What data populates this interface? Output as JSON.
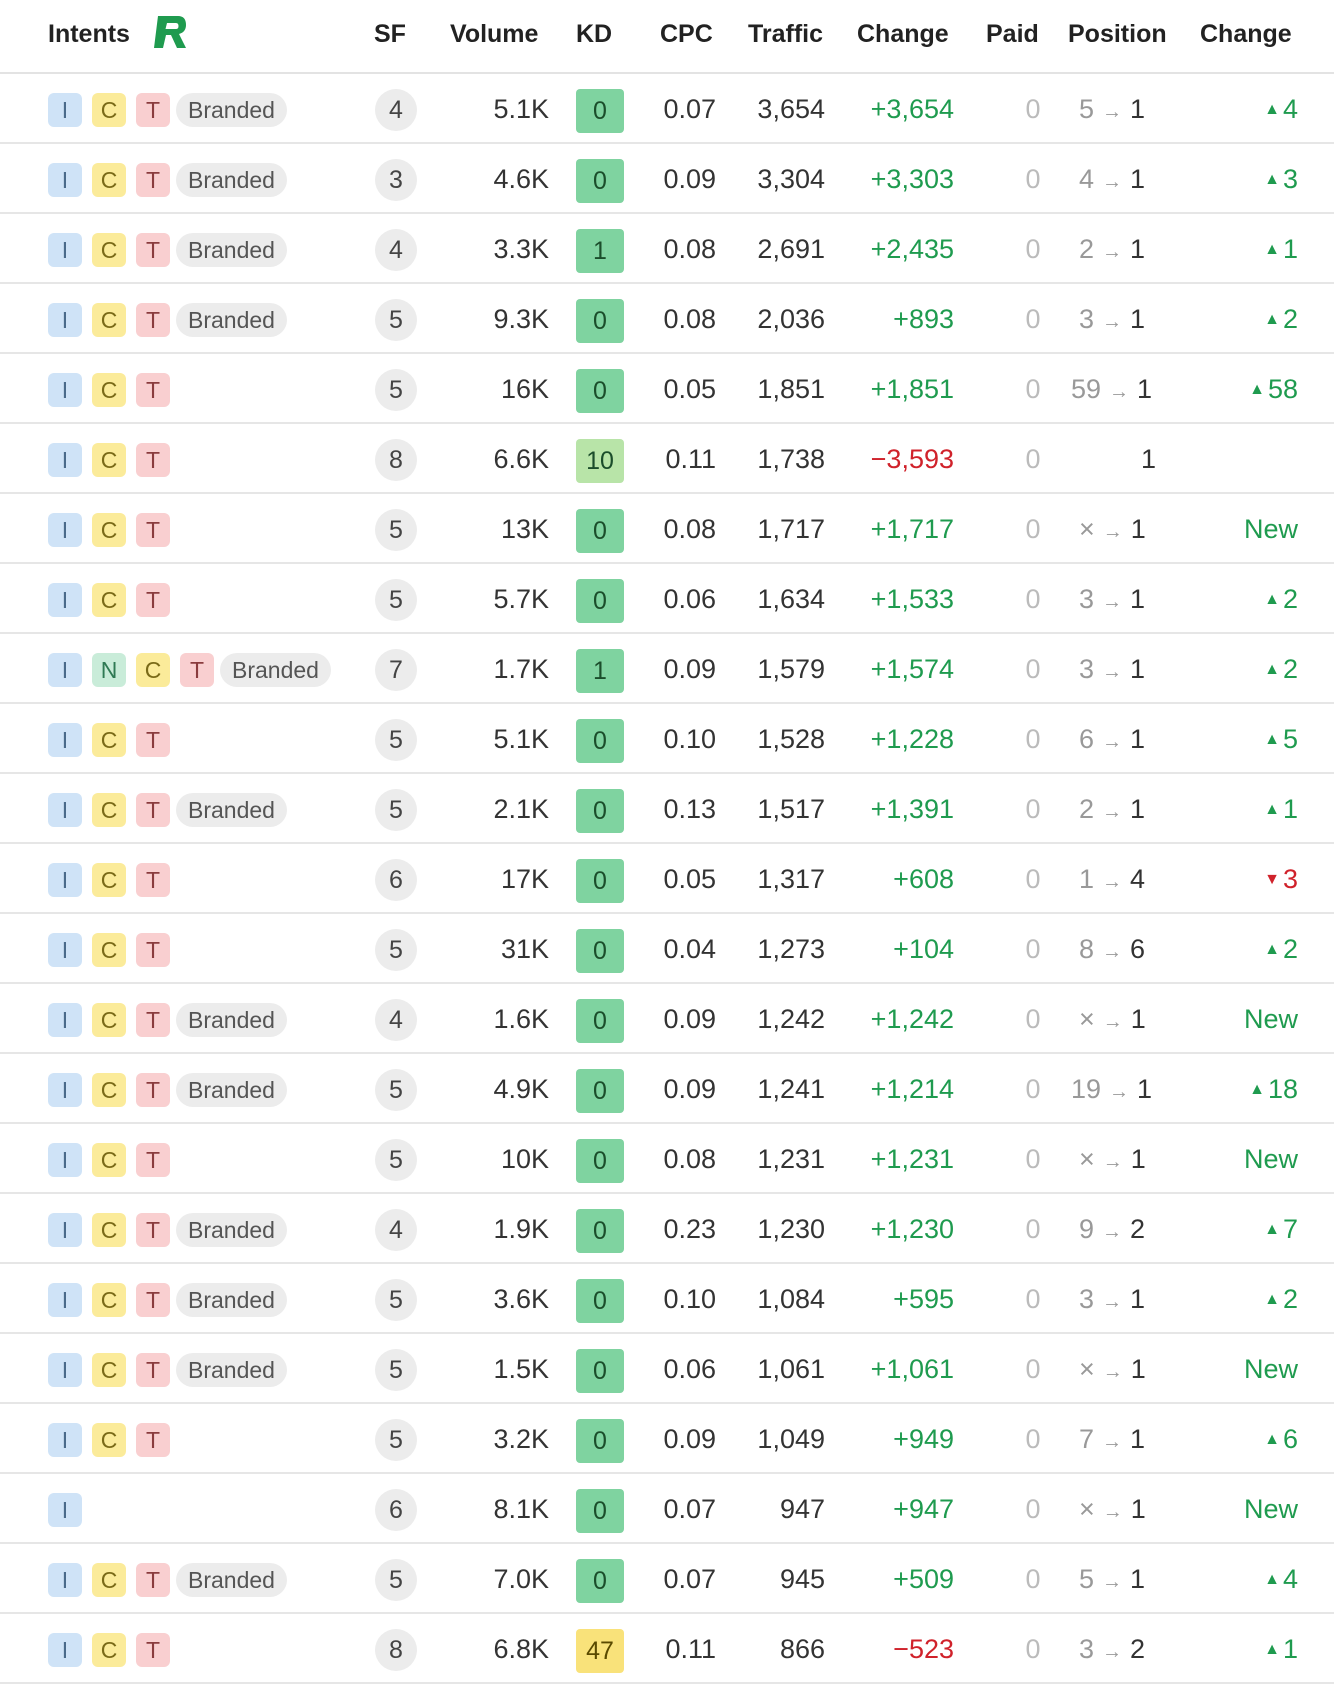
{
  "headers": {
    "intents": "Intents",
    "sf": "SF",
    "volume": "Volume",
    "kd": "KD",
    "cpc": "CPC",
    "traffic": "Traffic",
    "change": "Change",
    "paid": "Paid",
    "position": "Position",
    "pos_change": "Change"
  },
  "logo_icon": "r-logo-icon",
  "colors": {
    "intent_i": "#cfe3f7",
    "intent_n": "#c9ecd9",
    "intent_c": "#fbeb9a",
    "intent_t": "#f9cfd0",
    "kd_easy": "#7fd3a0",
    "kd_medium": "#f9e27a",
    "positive": "#1f9b4f",
    "negative": "#d0222b"
  },
  "rows": [
    {
      "intents": [
        "I",
        "C",
        "T"
      ],
      "branded": "Branded",
      "sf": "4",
      "volume": "5.1K",
      "kd": "0",
      "cpc": "0.07",
      "traffic": "3,654",
      "change": "+3,654",
      "paid": "0",
      "pos_from": "5",
      "pos_to": "1",
      "pos_change": "4",
      "dir": "up"
    },
    {
      "intents": [
        "I",
        "C",
        "T"
      ],
      "branded": "Branded",
      "sf": "3",
      "volume": "4.6K",
      "kd": "0",
      "cpc": "0.09",
      "traffic": "3,304",
      "change": "+3,303",
      "paid": "0",
      "pos_from": "4",
      "pos_to": "1",
      "pos_change": "3",
      "dir": "up"
    },
    {
      "intents": [
        "I",
        "C",
        "T"
      ],
      "branded": "Branded",
      "sf": "4",
      "volume": "3.3K",
      "kd": "1",
      "cpc": "0.08",
      "traffic": "2,691",
      "change": "+2,435",
      "paid": "0",
      "pos_from": "2",
      "pos_to": "1",
      "pos_change": "1",
      "dir": "up"
    },
    {
      "intents": [
        "I",
        "C",
        "T"
      ],
      "branded": "Branded",
      "sf": "5",
      "volume": "9.3K",
      "kd": "0",
      "cpc": "0.08",
      "traffic": "2,036",
      "change": "+893",
      "paid": "0",
      "pos_from": "3",
      "pos_to": "1",
      "pos_change": "2",
      "dir": "up"
    },
    {
      "intents": [
        "I",
        "C",
        "T"
      ],
      "branded": "",
      "sf": "5",
      "volume": "16K",
      "kd": "0",
      "cpc": "0.05",
      "traffic": "1,851",
      "change": "+1,851",
      "paid": "0",
      "pos_from": "59",
      "pos_to": "1",
      "pos_change": "58",
      "dir": "up"
    },
    {
      "intents": [
        "I",
        "C",
        "T"
      ],
      "branded": "",
      "sf": "8",
      "volume": "6.6K",
      "kd": "10",
      "cpc": "0.11",
      "traffic": "1,738",
      "change": "−3,593",
      "paid": "0",
      "pos_from": "",
      "pos_to": "1",
      "pos_change": "",
      "dir": "none"
    },
    {
      "intents": [
        "I",
        "C",
        "T"
      ],
      "branded": "",
      "sf": "5",
      "volume": "13K",
      "kd": "0",
      "cpc": "0.08",
      "traffic": "1,717",
      "change": "+1,717",
      "paid": "0",
      "pos_from": "×",
      "pos_to": "1",
      "pos_change": "New",
      "dir": "new"
    },
    {
      "intents": [
        "I",
        "C",
        "T"
      ],
      "branded": "",
      "sf": "5",
      "volume": "5.7K",
      "kd": "0",
      "cpc": "0.06",
      "traffic": "1,634",
      "change": "+1,533",
      "paid": "0",
      "pos_from": "3",
      "pos_to": "1",
      "pos_change": "2",
      "dir": "up"
    },
    {
      "intents": [
        "I",
        "N",
        "C",
        "T"
      ],
      "branded": "Branded",
      "sf": "7",
      "volume": "1.7K",
      "kd": "1",
      "cpc": "0.09",
      "traffic": "1,579",
      "change": "+1,574",
      "paid": "0",
      "pos_from": "3",
      "pos_to": "1",
      "pos_change": "2",
      "dir": "up"
    },
    {
      "intents": [
        "I",
        "C",
        "T"
      ],
      "branded": "",
      "sf": "5",
      "volume": "5.1K",
      "kd": "0",
      "cpc": "0.10",
      "traffic": "1,528",
      "change": "+1,228",
      "paid": "0",
      "pos_from": "6",
      "pos_to": "1",
      "pos_change": "5",
      "dir": "up"
    },
    {
      "intents": [
        "I",
        "C",
        "T"
      ],
      "branded": "Branded",
      "sf": "5",
      "volume": "2.1K",
      "kd": "0",
      "cpc": "0.13",
      "traffic": "1,517",
      "change": "+1,391",
      "paid": "0",
      "pos_from": "2",
      "pos_to": "1",
      "pos_change": "1",
      "dir": "up"
    },
    {
      "intents": [
        "I",
        "C",
        "T"
      ],
      "branded": "",
      "sf": "6",
      "volume": "17K",
      "kd": "0",
      "cpc": "0.05",
      "traffic": "1,317",
      "change": "+608",
      "paid": "0",
      "pos_from": "1",
      "pos_to": "4",
      "pos_change": "3",
      "dir": "down"
    },
    {
      "intents": [
        "I",
        "C",
        "T"
      ],
      "branded": "",
      "sf": "5",
      "volume": "31K",
      "kd": "0",
      "cpc": "0.04",
      "traffic": "1,273",
      "change": "+104",
      "paid": "0",
      "pos_from": "8",
      "pos_to": "6",
      "pos_change": "2",
      "dir": "up"
    },
    {
      "intents": [
        "I",
        "C",
        "T"
      ],
      "branded": "Branded",
      "sf": "4",
      "volume": "1.6K",
      "kd": "0",
      "cpc": "0.09",
      "traffic": "1,242",
      "change": "+1,242",
      "paid": "0",
      "pos_from": "×",
      "pos_to": "1",
      "pos_change": "New",
      "dir": "new"
    },
    {
      "intents": [
        "I",
        "C",
        "T"
      ],
      "branded": "Branded",
      "sf": "5",
      "volume": "4.9K",
      "kd": "0",
      "cpc": "0.09",
      "traffic": "1,241",
      "change": "+1,214",
      "paid": "0",
      "pos_from": "19",
      "pos_to": "1",
      "pos_change": "18",
      "dir": "up"
    },
    {
      "intents": [
        "I",
        "C",
        "T"
      ],
      "branded": "",
      "sf": "5",
      "volume": "10K",
      "kd": "0",
      "cpc": "0.08",
      "traffic": "1,231",
      "change": "+1,231",
      "paid": "0",
      "pos_from": "×",
      "pos_to": "1",
      "pos_change": "New",
      "dir": "new"
    },
    {
      "intents": [
        "I",
        "C",
        "T"
      ],
      "branded": "Branded",
      "sf": "4",
      "volume": "1.9K",
      "kd": "0",
      "cpc": "0.23",
      "traffic": "1,230",
      "change": "+1,230",
      "paid": "0",
      "pos_from": "9",
      "pos_to": "2",
      "pos_change": "7",
      "dir": "up"
    },
    {
      "intents": [
        "I",
        "C",
        "T"
      ],
      "branded": "Branded",
      "sf": "5",
      "volume": "3.6K",
      "kd": "0",
      "cpc": "0.10",
      "traffic": "1,084",
      "change": "+595",
      "paid": "0",
      "pos_from": "3",
      "pos_to": "1",
      "pos_change": "2",
      "dir": "up"
    },
    {
      "intents": [
        "I",
        "C",
        "T"
      ],
      "branded": "Branded",
      "sf": "5",
      "volume": "1.5K",
      "kd": "0",
      "cpc": "0.06",
      "traffic": "1,061",
      "change": "+1,061",
      "paid": "0",
      "pos_from": "×",
      "pos_to": "1",
      "pos_change": "New",
      "dir": "new"
    },
    {
      "intents": [
        "I",
        "C",
        "T"
      ],
      "branded": "",
      "sf": "5",
      "volume": "3.2K",
      "kd": "0",
      "cpc": "0.09",
      "traffic": "1,049",
      "change": "+949",
      "paid": "0",
      "pos_from": "7",
      "pos_to": "1",
      "pos_change": "6",
      "dir": "up"
    },
    {
      "intents": [
        "I"
      ],
      "branded": "",
      "sf": "6",
      "volume": "8.1K",
      "kd": "0",
      "cpc": "0.07",
      "traffic": "947",
      "change": "+947",
      "paid": "0",
      "pos_from": "×",
      "pos_to": "1",
      "pos_change": "New",
      "dir": "new"
    },
    {
      "intents": [
        "I",
        "C",
        "T"
      ],
      "branded": "Branded",
      "sf": "5",
      "volume": "7.0K",
      "kd": "0",
      "cpc": "0.07",
      "traffic": "945",
      "change": "+509",
      "paid": "0",
      "pos_from": "5",
      "pos_to": "1",
      "pos_change": "4",
      "dir": "up"
    },
    {
      "intents": [
        "I",
        "C",
        "T"
      ],
      "branded": "",
      "sf": "8",
      "volume": "6.8K",
      "kd": "47",
      "cpc": "0.11",
      "traffic": "866",
      "change": "−523",
      "paid": "0",
      "pos_from": "3",
      "pos_to": "2",
      "pos_change": "1",
      "dir": "up"
    }
  ]
}
